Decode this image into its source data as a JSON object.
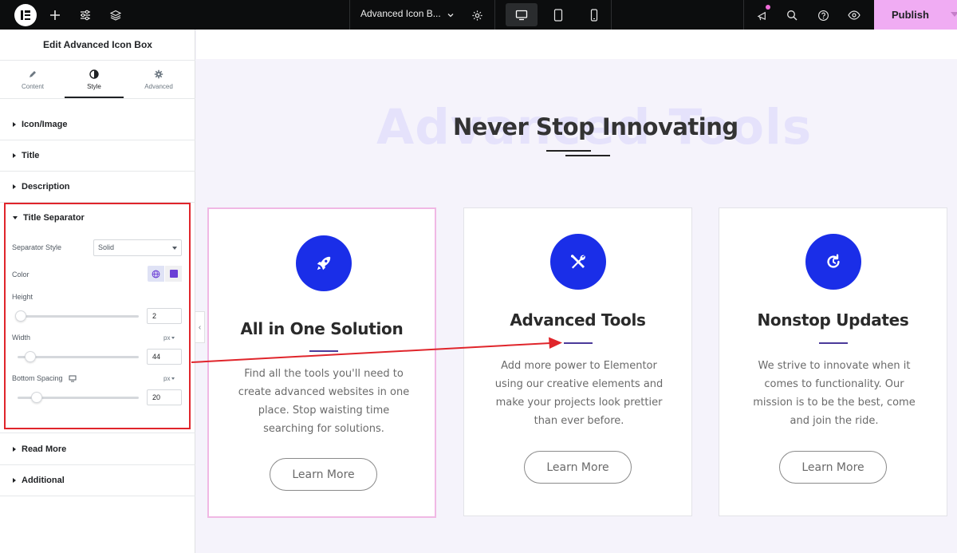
{
  "topbar": {
    "document_title": "Advanced Icon B...",
    "publish_label": "Publish"
  },
  "panel": {
    "title": "Edit Advanced Icon Box",
    "tabs": [
      {
        "label": "Content",
        "icon": "pencil-icon"
      },
      {
        "label": "Style",
        "icon": "contrast-icon"
      },
      {
        "label": "Advanced",
        "icon": "gear-icon"
      }
    ],
    "active_tab": "Style",
    "sections": {
      "icon_image": "Icon/Image",
      "title": "Title",
      "description": "Description",
      "title_separator": "Title Separator",
      "read_more": "Read More",
      "additional": "Additional"
    },
    "controls": {
      "separator_style_label": "Separator Style",
      "separator_style_value": "Solid",
      "color_label": "Color",
      "color_value": "#6b3fd6",
      "height_label": "Height",
      "height_value": "2",
      "width_label": "Width",
      "width_unit": "px",
      "width_value": "44",
      "bottom_spacing_label": "Bottom Spacing",
      "bottom_spacing_unit": "px",
      "bottom_spacing_value": "20"
    }
  },
  "canvas": {
    "background_text": "Advanced Tools",
    "heading": "Never Stop Innovating",
    "cards": [
      {
        "icon": "rocket-icon",
        "title": "All in One Solution",
        "description": "Find all the tools you'll need to create advanced websites in one place. Stop waisting time searching for solutions.",
        "button": "Learn More"
      },
      {
        "icon": "tools-icon",
        "title": "Advanced Tools",
        "description": "Add more power to Elementor using our creative elements and make your projects look prettier than ever before.",
        "button": "Learn More"
      },
      {
        "icon": "refresh-icon",
        "title": "Nonstop Updates",
        "description": "We strive to innovate when it comes to functionality. Our mission is to be the best, come and join the ride.",
        "button": "Learn More"
      }
    ]
  },
  "colors": {
    "accent_blue": "#1a2ee8",
    "publish_pink": "#f0acf3",
    "highlight_red": "#e0252b",
    "separator_purple": "#4b3a9a"
  }
}
